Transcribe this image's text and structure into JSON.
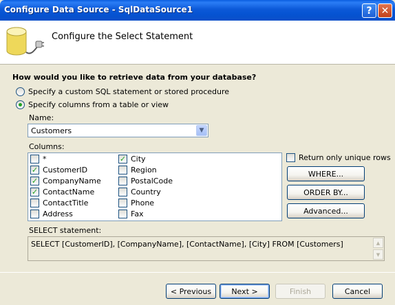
{
  "window": {
    "title": "Configure Data Source - SqlDataSource1"
  },
  "titlebar": {
    "help_label": "?",
    "close_label": "✕"
  },
  "header": {
    "heading": "Configure the Select Statement",
    "icon": "database-plug-icon"
  },
  "prompt": "How would you like to retrieve data from your database?",
  "options": [
    {
      "label": "Specify a custom SQL statement or stored procedure",
      "selected": false
    },
    {
      "label": "Specify columns from a table or view",
      "selected": true
    }
  ],
  "name": {
    "label": "Name:",
    "value": "Customers"
  },
  "columns": {
    "label": "Columns:",
    "items": [
      {
        "label": "*",
        "checked": false
      },
      {
        "label": "CustomerID",
        "checked": true
      },
      {
        "label": "CompanyName",
        "checked": true
      },
      {
        "label": "ContactName",
        "checked": true
      },
      {
        "label": "ContactTitle",
        "checked": false
      },
      {
        "label": "Address",
        "checked": false
      },
      {
        "label": "City",
        "checked": true
      },
      {
        "label": "Region",
        "checked": false
      },
      {
        "label": "PostalCode",
        "checked": false
      },
      {
        "label": "Country",
        "checked": false
      },
      {
        "label": "Phone",
        "checked": false
      },
      {
        "label": "Fax",
        "checked": false
      }
    ]
  },
  "side": {
    "unique_rows_label": "Return only unique rows",
    "unique_rows_checked": false,
    "where_label": "WHERE...",
    "orderby_label": "ORDER BY...",
    "advanced_label": "Advanced..."
  },
  "select_statement": {
    "label": "SELECT statement:",
    "value": "SELECT [CustomerID], [CompanyName], [ContactName], [City] FROM [Customers]"
  },
  "footer": {
    "previous_label": "< Previous",
    "next_label": "Next >",
    "finish_label": "Finish",
    "cancel_label": "Cancel"
  },
  "colors": {
    "titlebar": "#0553d2",
    "dialog_bg": "#ece9d8",
    "check_green": "#21a121"
  }
}
